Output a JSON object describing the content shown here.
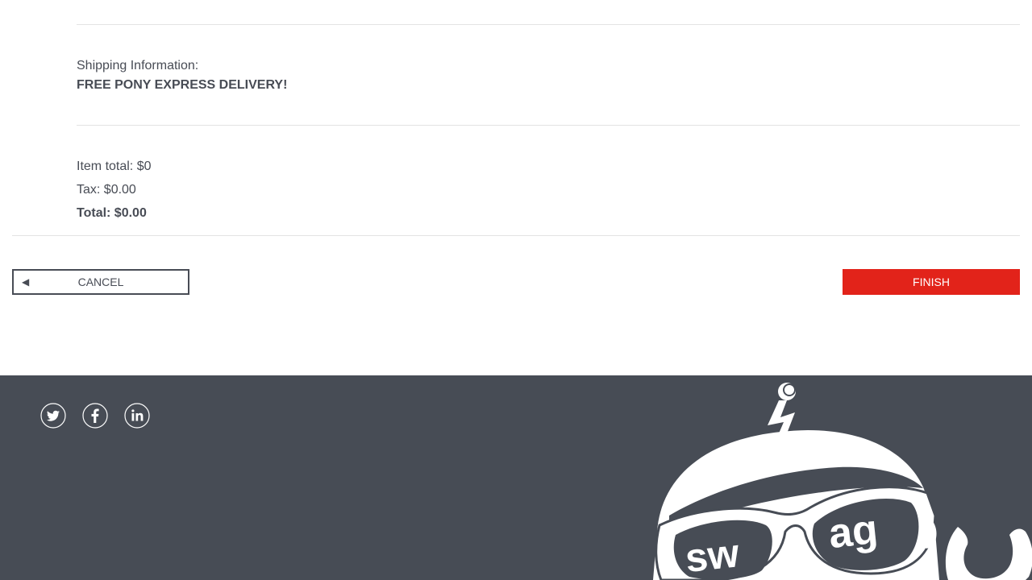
{
  "shipping": {
    "label": "Shipping Information:",
    "value": "FREE PONY EXPRESS DELIVERY!"
  },
  "summary": {
    "item_total": "Item total: $0",
    "tax": "Tax: $0.00",
    "total": "Total: $0.00"
  },
  "buttons": {
    "cancel_arrow": "◀",
    "cancel_label": "CANCEL",
    "finish_label": "FINISH"
  },
  "footer": {
    "social": [
      "twitter-icon",
      "facebook-icon",
      "linkedin-icon"
    ],
    "logo_text": "swag"
  },
  "colors": {
    "accent": "#e2231a",
    "footer_bg": "#474c55",
    "text": "#484c55"
  }
}
